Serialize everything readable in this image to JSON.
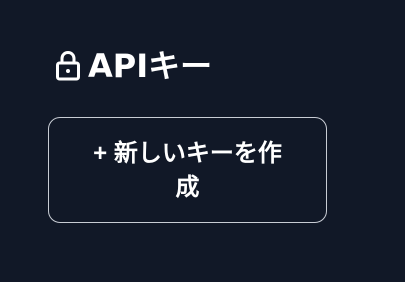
{
  "header": {
    "lock_icon": "lock-icon",
    "title": "APIキー"
  },
  "actions": {
    "create_key_label": "+ 新しいキーを作成"
  },
  "colors": {
    "background": "#111827",
    "text": "#ffffff",
    "button_border": "#c8ccd4"
  }
}
